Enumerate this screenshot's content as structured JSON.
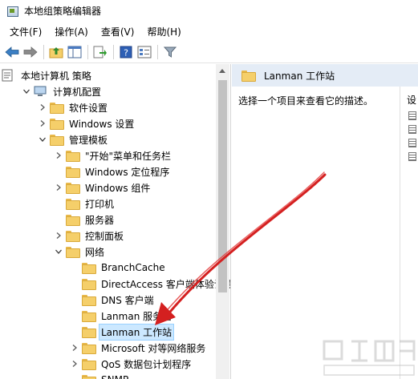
{
  "window": {
    "title": "本地组策略编辑器"
  },
  "menu": [
    {
      "label": "文件(F)"
    },
    {
      "label": "操作(A)"
    },
    {
      "label": "查看(V)"
    },
    {
      "label": "帮助(H)"
    }
  ],
  "toolbar": {
    "buttons": [
      "back-arrow-icon",
      "forward-arrow-icon",
      "up-folder-icon",
      "show-hide-tree-icon",
      "export-list-icon",
      "help-icon",
      "properties-icon",
      "filter-icon"
    ]
  },
  "tree": {
    "items": [
      {
        "label": "本地计算机 策略",
        "level": 0,
        "expander": "none",
        "icon": "computer-policy-icon"
      },
      {
        "label": "计算机配置",
        "level": 1,
        "expander": "expanded",
        "icon": "computer-config-icon"
      },
      {
        "label": "软件设置",
        "level": 2,
        "expander": "collapsed",
        "icon": "folder-icon"
      },
      {
        "label": "Windows 设置",
        "level": 2,
        "expander": "collapsed",
        "icon": "folder-icon"
      },
      {
        "label": "管理模板",
        "level": 2,
        "expander": "expanded",
        "icon": "folder-icon"
      },
      {
        "label": "\"开始\"菜单和任务栏",
        "level": 3,
        "expander": "collapsed",
        "icon": "folder-icon"
      },
      {
        "label": "Windows 定位程序",
        "level": 3,
        "expander": "none",
        "icon": "folder-icon"
      },
      {
        "label": "Windows 组件",
        "level": 3,
        "expander": "collapsed",
        "icon": "folder-icon"
      },
      {
        "label": "打印机",
        "level": 3,
        "expander": "none",
        "icon": "folder-icon"
      },
      {
        "label": "服务器",
        "level": 3,
        "expander": "none",
        "icon": "folder-icon"
      },
      {
        "label": "控制面板",
        "level": 3,
        "expander": "collapsed",
        "icon": "folder-icon"
      },
      {
        "label": "网络",
        "level": 3,
        "expander": "expanded",
        "icon": "folder-icon"
      },
      {
        "label": "BranchCache",
        "level": 4,
        "expander": "none",
        "icon": "folder-icon"
      },
      {
        "label": "DirectAccess 客户端体验设置",
        "level": 4,
        "expander": "none",
        "icon": "folder-icon"
      },
      {
        "label": "DNS 客户端",
        "level": 4,
        "expander": "none",
        "icon": "folder-icon"
      },
      {
        "label": "Lanman 服务器",
        "level": 4,
        "expander": "none",
        "icon": "folder-icon"
      },
      {
        "label": "Lanman 工作站",
        "level": 4,
        "expander": "none",
        "icon": "folder-icon",
        "selected": true
      },
      {
        "label": "Microsoft 对等网络服务",
        "level": 4,
        "expander": "collapsed",
        "icon": "folder-icon"
      },
      {
        "label": "QoS 数据包计划程序",
        "level": 4,
        "expander": "collapsed",
        "icon": "folder-icon"
      },
      {
        "label": "SNMP",
        "level": 4,
        "expander": "none",
        "icon": "folder-icon"
      }
    ]
  },
  "right_pane": {
    "header": "Lanman 工作站",
    "description": "选择一个项目来查看它的描述。",
    "column_header": "设",
    "setting_count": 4
  },
  "colors": {
    "selection": "#cce8ff",
    "header_bg": "#e4ecf6",
    "arrow": "#d42020"
  }
}
